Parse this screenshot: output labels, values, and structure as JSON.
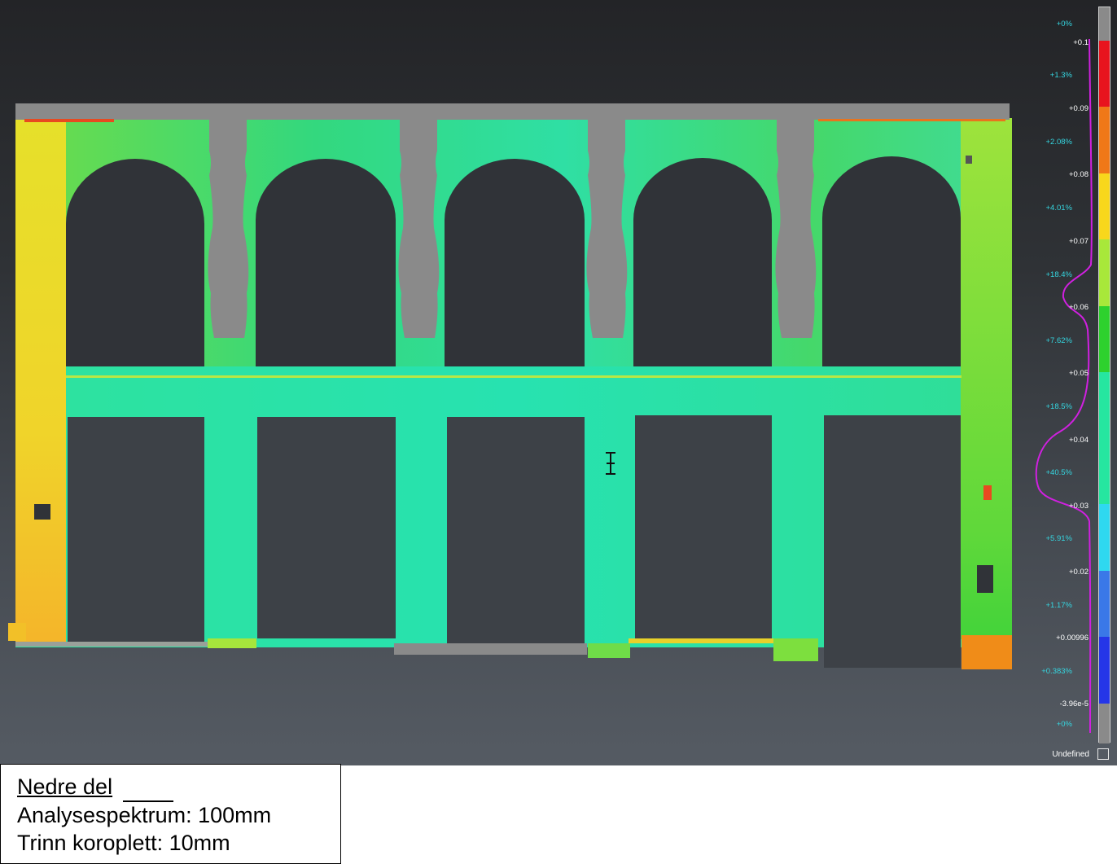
{
  "scale": {
    "values": [
      "+0.1",
      "+0.09",
      "+0.08",
      "+0.07",
      "+0.06",
      "+0.05",
      "+0.04",
      "+0.03",
      "+0.02",
      "+0.00996",
      "-3.96e-5"
    ],
    "percentages": [
      "+0%",
      "+1.3%",
      "+2.08%",
      "+4.01%",
      "+18.4%",
      "+7.62%",
      "+18.5%",
      "+40.5%",
      "+5.91%",
      "+1.17%",
      "+0.383%",
      "+0%"
    ],
    "colors": [
      "#e8141e",
      "#f07818",
      "#f8d71c",
      "#a8e83a",
      "#2ed12e",
      "#26e6a0",
      "#2fd8f0",
      "#3a78e8",
      "#2536e8"
    ],
    "undefined_label": "Undefined"
  },
  "caption": {
    "title": "Nedre del",
    "line2": "Analysespektrum: 100mm",
    "line3": "Trinn koroplett: 10mm"
  }
}
